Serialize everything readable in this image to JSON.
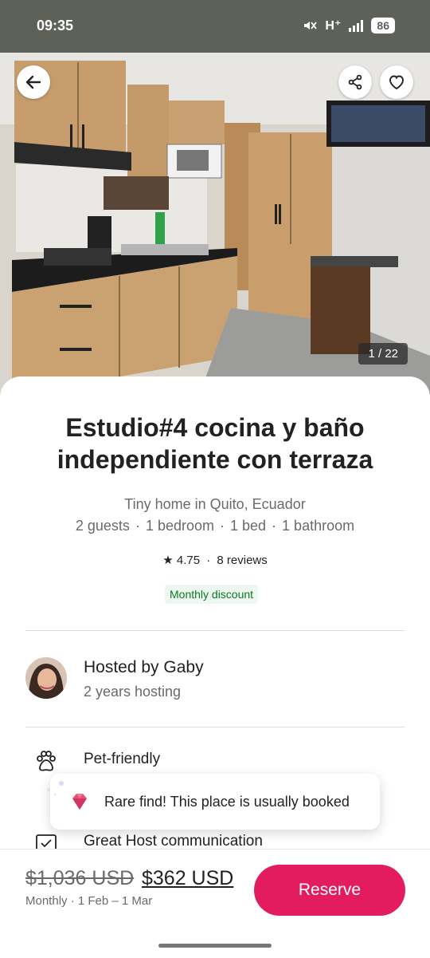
{
  "status_bar": {
    "time": "09:35",
    "network": "H⁺",
    "battery": "86",
    "icons": [
      "mute-icon",
      "signal-icon",
      "battery-icon"
    ]
  },
  "photo": {
    "counter": "1 / 22",
    "icons": [
      "back-arrow-icon",
      "share-icon",
      "heart-icon"
    ]
  },
  "listing": {
    "title": "Estudio#4 cocina y baño independiente con terraza",
    "subtitle": "Tiny home in Quito, Ecuador",
    "details": [
      "2 guests",
      "1 bedroom",
      "1 bed",
      "1 bathroom"
    ],
    "rating": "4.75",
    "reviews": "8 reviews",
    "discount": "Monthly discount"
  },
  "host": {
    "name": "Hosted by Gaby",
    "years": "2 years hosting"
  },
  "features": [
    {
      "label": "Pet-friendly",
      "icon": "paw-icon"
    },
    {
      "label": "Great Host communication",
      "icon": "chat-check-icon"
    }
  ],
  "toast": {
    "text": "Rare find! This place is usually booked",
    "icon": "gem-icon"
  },
  "footer": {
    "price_old": "$1,036 USD",
    "price_new": "$362 USD",
    "dates": "Monthly · 1 Feb – 1 Mar",
    "reserve_label": "Reserve"
  },
  "colors": {
    "brand": "#e31c5f",
    "discount_text": "#0a7a24",
    "discount_bg": "#eef7ef",
    "status_bar": "#5e6158"
  }
}
